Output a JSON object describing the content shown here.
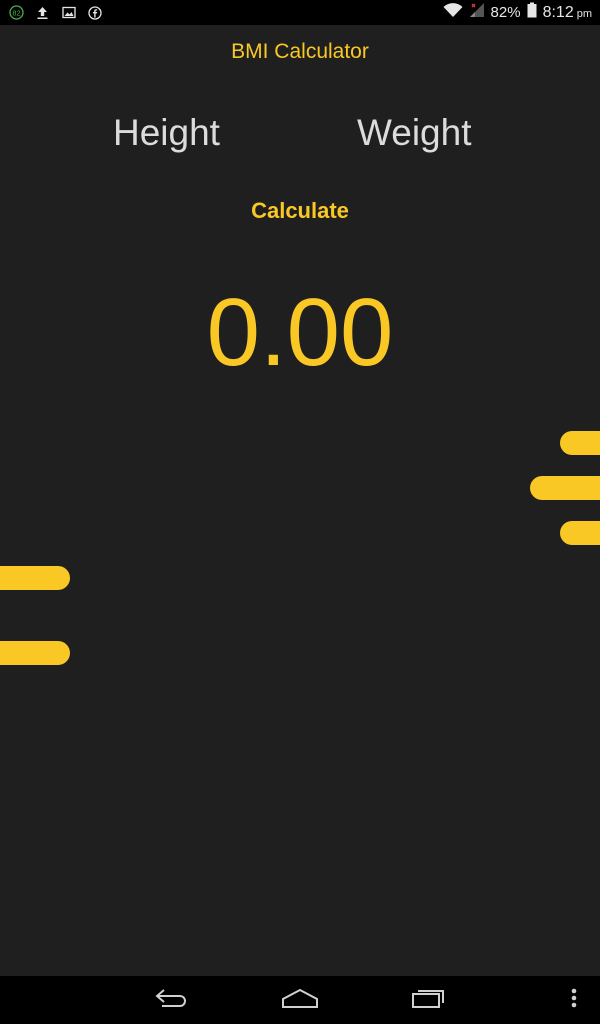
{
  "status_bar": {
    "notification_badge": "82",
    "icons": [
      "notification-badge-icon",
      "upload-icon",
      "image-icon",
      "facebook-icon"
    ],
    "wifi_icon": "wifi-icon",
    "signal_icon": "signal-icon",
    "battery_percent": "82%",
    "battery_icon": "battery-icon",
    "time": "8:12",
    "ampm": "pm"
  },
  "app": {
    "title": "BMI Calculator",
    "height_label": "Height",
    "weight_label": "Weight",
    "calculate_label": "Calculate",
    "result_value": "0.00"
  },
  "nav_bar": {
    "back_icon": "back-icon",
    "home_icon": "home-icon",
    "recents_icon": "recents-icon",
    "menu_icon": "overflow-menu-icon"
  },
  "colors": {
    "accent": "#fac825",
    "background": "#1f1f1f",
    "text_light": "#dcdcdc",
    "bar_background": "#000000"
  }
}
